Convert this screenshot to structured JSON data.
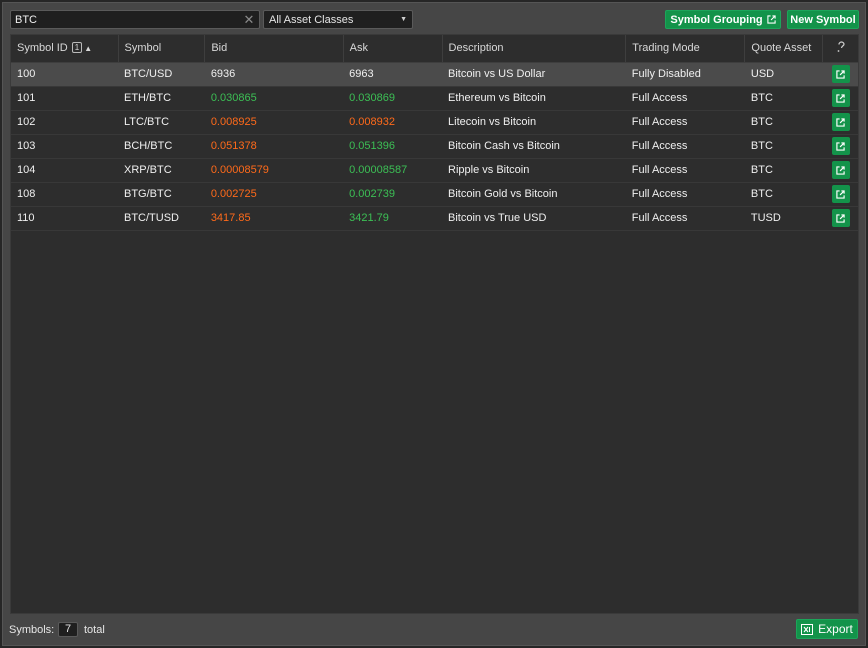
{
  "toolbar": {
    "search_value": "BTC",
    "asset_filter": "All Asset Classes",
    "symbol_grouping_label": "Symbol Grouping",
    "new_symbol_label": "New Symbol"
  },
  "columns": [
    "Symbol ID",
    "Symbol",
    "Bid",
    "Ask",
    "Description",
    "Trading Mode",
    "Quote Asset"
  ],
  "sort": {
    "badge": "1",
    "direction": "ascending"
  },
  "rows": [
    {
      "id": "100",
      "symbol": "BTC/USD",
      "bid": "6936",
      "bid_trend": "neutral",
      "ask": "6963",
      "ask_trend": "neutral",
      "description": "Bitcoin vs US Dollar",
      "mode": "Fully Disabled",
      "quote": "USD"
    },
    {
      "id": "101",
      "symbol": "ETH/BTC",
      "bid": "0.030865",
      "bid_trend": "up",
      "ask": "0.030869",
      "ask_trend": "up",
      "description": "Ethereum vs Bitcoin",
      "mode": "Full Access",
      "quote": "BTC"
    },
    {
      "id": "102",
      "symbol": "LTC/BTC",
      "bid": "0.008925",
      "bid_trend": "down",
      "ask": "0.008932",
      "ask_trend": "down",
      "description": "Litecoin vs Bitcoin",
      "mode": "Full Access",
      "quote": "BTC"
    },
    {
      "id": "103",
      "symbol": "BCH/BTC",
      "bid": "0.051378",
      "bid_trend": "down",
      "ask": "0.051396",
      "ask_trend": "up",
      "description": "Bitcoin Cash vs Bitcoin",
      "mode": "Full Access",
      "quote": "BTC"
    },
    {
      "id": "104",
      "symbol": "XRP/BTC",
      "bid": "0.00008579",
      "bid_trend": "down",
      "ask": "0.00008587",
      "ask_trend": "up",
      "description": "Ripple vs Bitcoin",
      "mode": "Full Access",
      "quote": "BTC"
    },
    {
      "id": "108",
      "symbol": "BTG/BTC",
      "bid": "0.002725",
      "bid_trend": "down",
      "ask": "0.002739",
      "ask_trend": "up",
      "description": "Bitcoin Gold vs Bitcoin",
      "mode": "Full Access",
      "quote": "BTC"
    },
    {
      "id": "110",
      "symbol": "BTC/TUSD",
      "bid": "3417.85",
      "bid_trend": "down",
      "ask": "3421.79",
      "ask_trend": "up",
      "description": "Bitcoin vs True USD",
      "mode": "Full Access",
      "quote": "TUSD"
    }
  ],
  "footer": {
    "symbols_label": "Symbols:",
    "count": "7",
    "total_label": "total",
    "export_label": "Export"
  },
  "colors": {
    "accent_green": "#13934a",
    "price_up": "#3cbf55",
    "price_down": "#ff6a1a",
    "selected_row": "#4b4b4b"
  },
  "icons": {
    "clear": "close-icon",
    "dropdown": "chevron-down-icon",
    "external": "external-link-icon",
    "export": "spreadsheet-icon",
    "help": "help-icon"
  }
}
